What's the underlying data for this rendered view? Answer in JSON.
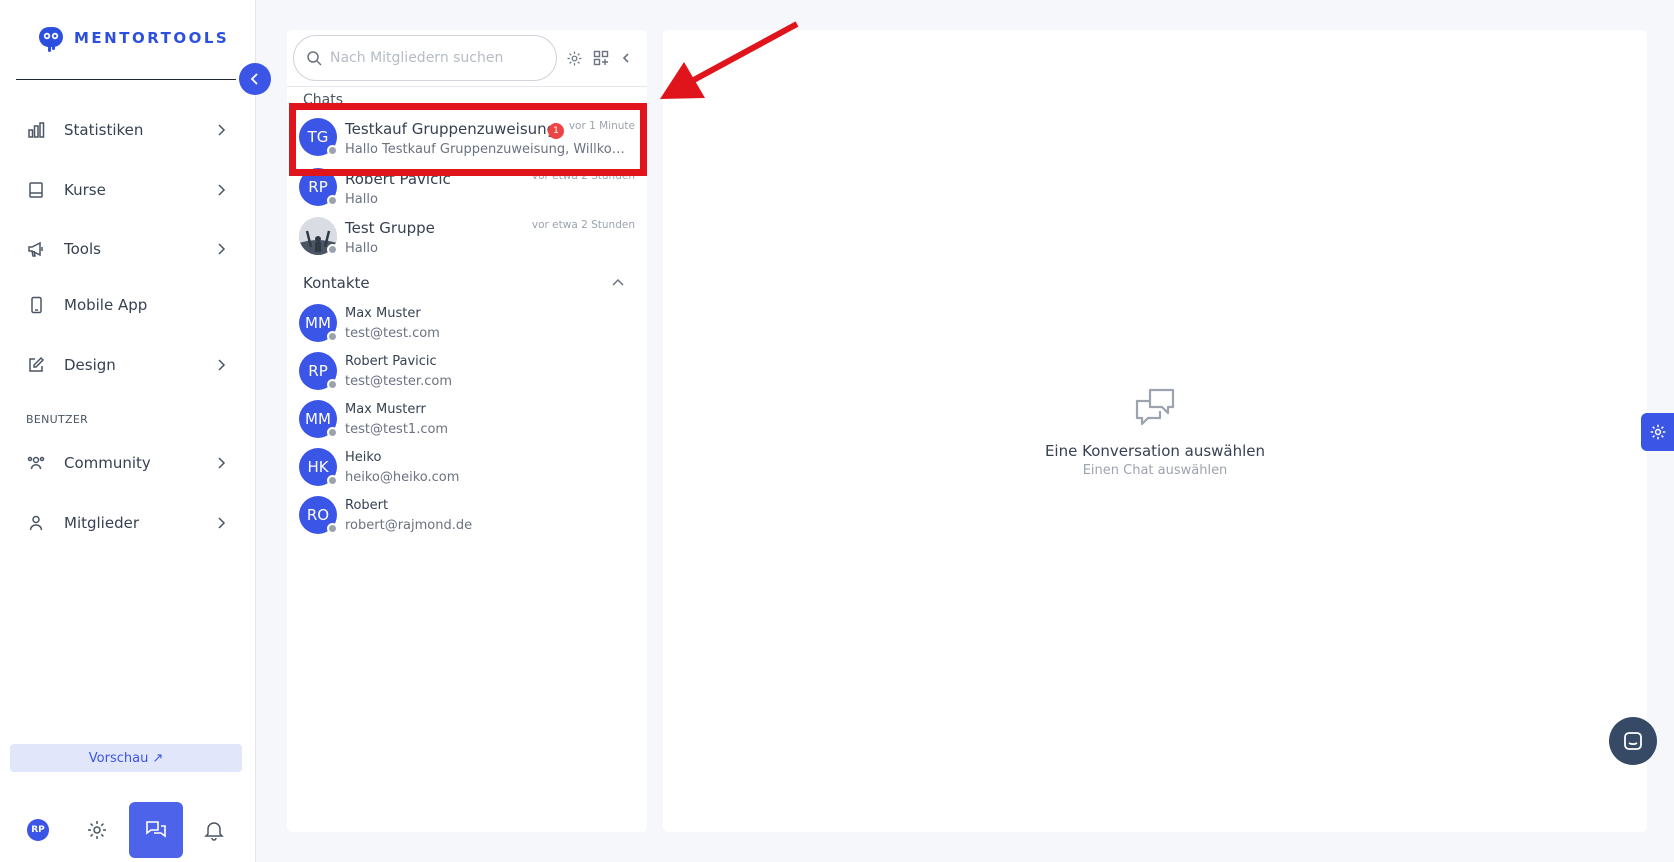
{
  "brand": {
    "name": "MENTORTOOLS",
    "color": "#2d4fe0"
  },
  "sidebar": {
    "items": [
      {
        "label": "Statistiken",
        "icon": "bar-chart-icon",
        "has_chevron": true
      },
      {
        "label": "Kurse",
        "icon": "book-icon",
        "has_chevron": true
      },
      {
        "label": "Tools",
        "icon": "megaphone-icon",
        "has_chevron": true
      },
      {
        "label": "Mobile App",
        "icon": "smartphone-icon",
        "has_chevron": false
      },
      {
        "label": "Design",
        "icon": "pen-icon",
        "has_chevron": true
      }
    ],
    "section_label": "BENUTZER",
    "user_items": [
      {
        "label": "Community",
        "icon": "users-icon",
        "has_chevron": true
      },
      {
        "label": "Mitglieder",
        "icon": "user-icon",
        "has_chevron": true
      }
    ],
    "preview_label": "Vorschau",
    "bottom": {
      "avatar_initials": "RP"
    }
  },
  "chat": {
    "search_placeholder": "Nach Mitgliedern suchen",
    "chats_heading": "Chats",
    "conversations": [
      {
        "initials": "TG",
        "name": "Testkauf Gruppenzuweisung",
        "message": "Hallo Testkauf Gruppenzuweisung, Willkomm...",
        "time": "vor 1 Minute",
        "unread": "1"
      },
      {
        "initials": "RP",
        "name": "Robert Pavicic",
        "message": "Hallo",
        "time": "vor etwa 2 Stunden"
      },
      {
        "initials": "",
        "name": "Test Gruppe",
        "message": "Hallo",
        "time": "vor etwa 2 Stunden",
        "photo": true
      }
    ],
    "contacts_heading": "Kontakte",
    "contacts": [
      {
        "initials": "MM",
        "name": "Max Muster",
        "email": "test@test.com"
      },
      {
        "initials": "RP",
        "name": "Robert Pavicic",
        "email": "test@tester.com"
      },
      {
        "initials": "MM",
        "name": "Max Musterr",
        "email": "test@test1.com"
      },
      {
        "initials": "HK",
        "name": "Heiko",
        "email": "heiko@heiko.com"
      },
      {
        "initials": "RO",
        "name": "Robert",
        "email": "robert@rajmond.de"
      }
    ]
  },
  "conversation": {
    "empty_title": "Eine Konversation auswählen",
    "empty_subtitle": "Einen Chat auswählen"
  },
  "colors": {
    "accent": "#3b55e6",
    "highlight": "#e0141b",
    "badge": "#ef4444"
  }
}
